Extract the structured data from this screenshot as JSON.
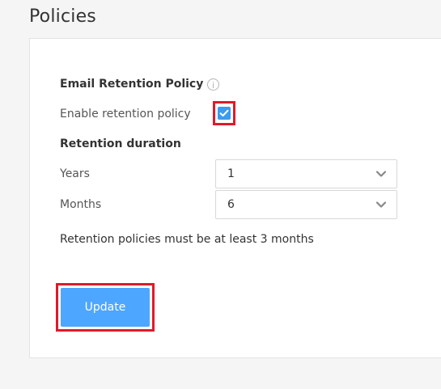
{
  "page": {
    "title": "Policies"
  },
  "policy": {
    "section_title": "Email Retention Policy",
    "info_icon": "info-icon",
    "enable_label": "Enable retention policy",
    "enable_checked": true,
    "duration_title": "Retention duration",
    "years": {
      "label": "Years",
      "value": "1"
    },
    "months": {
      "label": "Months",
      "value": "6"
    },
    "note": "Retention policies must be at least 3 months"
  },
  "actions": {
    "update_label": "Update"
  },
  "colors": {
    "accent": "#3a9cf0",
    "button": "#4da6ff",
    "highlight": "#e0192b"
  }
}
